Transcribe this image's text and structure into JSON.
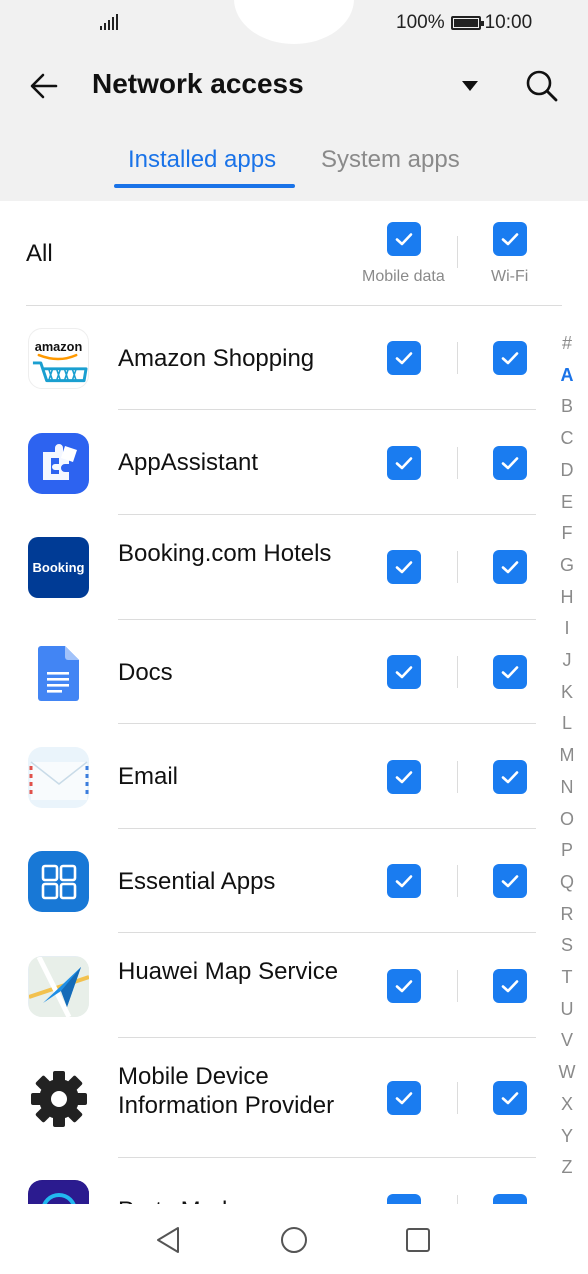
{
  "status_bar": {
    "battery": "100%",
    "time": "10:00"
  },
  "header": {
    "title": "Network access"
  },
  "tabs": [
    {
      "label": "Installed apps",
      "active": true
    },
    {
      "label": "System apps",
      "active": false
    }
  ],
  "all_row": {
    "label": "All",
    "mobile_data_label": "Mobile data",
    "wifi_label": "Wi-Fi",
    "mobile_data_checked": true,
    "wifi_checked": true
  },
  "apps": [
    {
      "name": "Amazon Shopping",
      "icon": "amazon-icon",
      "mobile_data": true,
      "wifi": true
    },
    {
      "name": "AppAssistant",
      "icon": "puzzle-icon",
      "mobile_data": true,
      "wifi": true
    },
    {
      "name": "Booking.com Hotels",
      "icon": "booking-icon",
      "icon_text": "Booking",
      "mobile_data": true,
      "wifi": true
    },
    {
      "name": "Docs",
      "icon": "docs-icon",
      "mobile_data": true,
      "wifi": true
    },
    {
      "name": "Email",
      "icon": "envelope-icon",
      "mobile_data": true,
      "wifi": true
    },
    {
      "name": "Essential Apps",
      "icon": "grid-icon",
      "mobile_data": true,
      "wifi": true
    },
    {
      "name": "Huawei Map Service",
      "icon": "map-icon",
      "mobile_data": true,
      "wifi": true
    },
    {
      "name": "Mobile Device Information Provider",
      "icon": "gear-icon",
      "mobile_data": true,
      "wifi": true
    },
    {
      "name": "Party Mode",
      "icon": "party-icon",
      "mobile_data": true,
      "wifi": true
    }
  ],
  "alphabet": [
    "#",
    "A",
    "B",
    "C",
    "D",
    "E",
    "F",
    "G",
    "H",
    "I",
    "J",
    "K",
    "L",
    "M",
    "N",
    "O",
    "P",
    "Q",
    "R",
    "S",
    "T",
    "U",
    "V",
    "W",
    "X",
    "Y",
    "Z"
  ],
  "alphabet_active": "A",
  "colors": {
    "accent": "#1a73e8",
    "checkbox": "#1a7cf0"
  }
}
